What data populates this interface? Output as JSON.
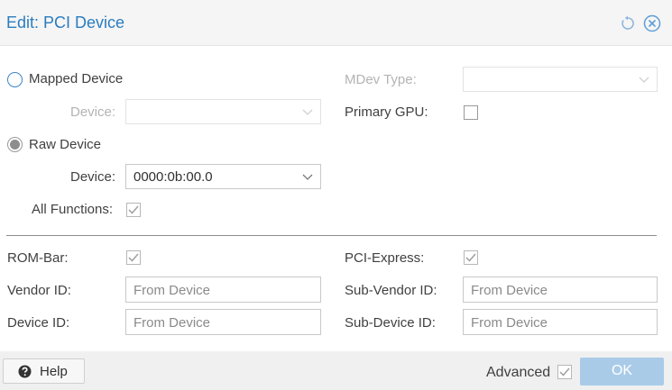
{
  "dialog": {
    "title": "Edit: PCI Device"
  },
  "mapped": {
    "label": "Mapped Device",
    "device_label": "Device:"
  },
  "mdev": {
    "label": "MDev Type:"
  },
  "primary_gpu": {
    "label": "Primary GPU:",
    "checked": false
  },
  "raw": {
    "label": "Raw Device",
    "device_label": "Device:",
    "device_value": "0000:0b:00.0"
  },
  "all_functions": {
    "label": "All Functions:",
    "checked": true
  },
  "rombar": {
    "label": "ROM-Bar:",
    "checked": true
  },
  "pcie": {
    "label": "PCI-Express:",
    "checked": true
  },
  "vendor_id": {
    "label": "Vendor ID:",
    "placeholder": "From Device"
  },
  "sub_vendor_id": {
    "label": "Sub-Vendor ID:",
    "placeholder": "From Device"
  },
  "device_id": {
    "label": "Device ID:",
    "placeholder": "From Device"
  },
  "sub_device_id": {
    "label": "Sub-Device ID:",
    "placeholder": "From Device"
  },
  "footer": {
    "help_label": "Help",
    "advanced_label": "Advanced",
    "advanced_checked": true,
    "ok_label": "OK"
  },
  "icons": {
    "reset": "reset-icon",
    "close": "close-icon",
    "help": "question-circle-icon"
  },
  "colors": {
    "title": "#2a7dc0",
    "ok_button": "#a9cbe8",
    "radio_unselected": "#3b86c8"
  }
}
